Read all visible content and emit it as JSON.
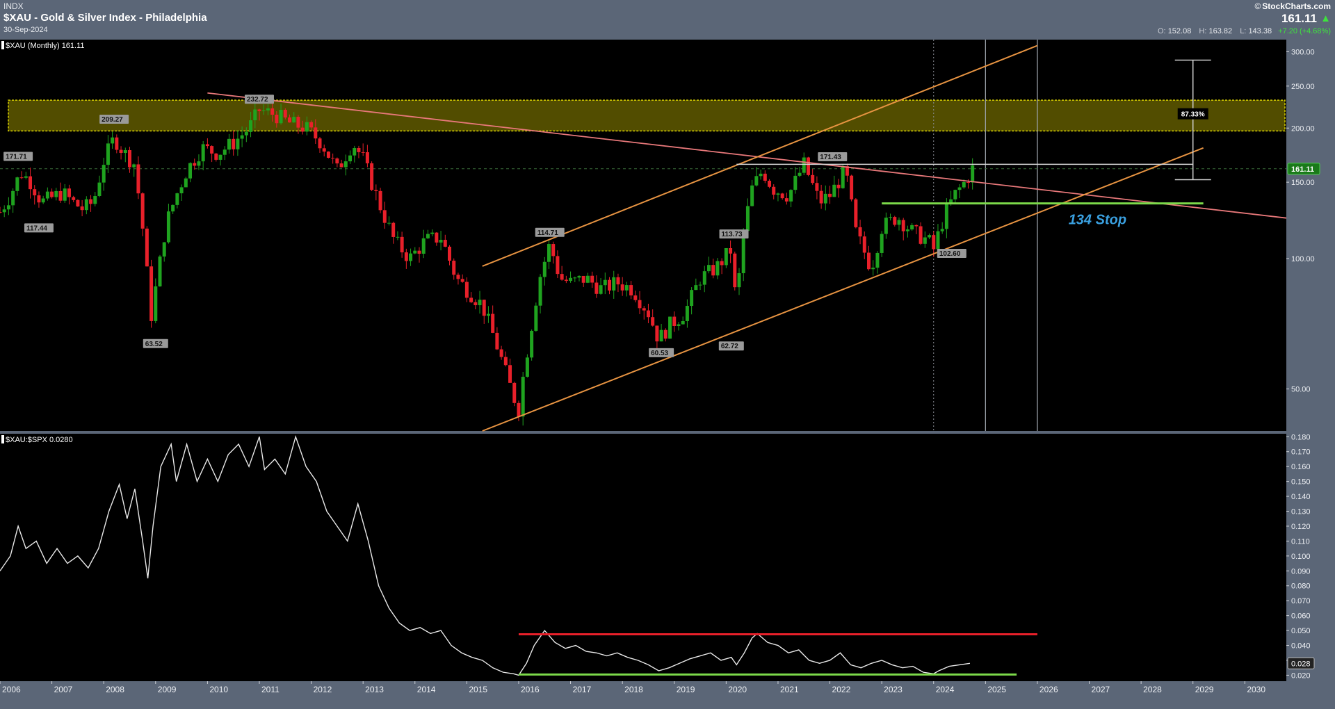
{
  "header": {
    "exchange": "INDX",
    "title": "$XAU - Gold & Silver Index - Philadelphia",
    "date": "30-Sep-2024",
    "brand": "StockCharts.com",
    "copyright": "©",
    "last_price": "161.11",
    "up_arrow": "▲",
    "open_label": "O:",
    "open": "152.08",
    "high_label": "H:",
    "high": "163.82",
    "low_label": "L:",
    "low": "143.38",
    "change": "+7.20 (+4.68%)"
  },
  "colors": {
    "panel_bg": "#000000",
    "frame": "#5b6677",
    "up_candle": "#1fa31f",
    "down_candle": "#e8202a",
    "trendline": "#e8787a",
    "channel": "#e89442",
    "zone": "#d8d000",
    "support": "#7cd94a",
    "resistance": "#e8202a",
    "ratio_line": "#e8e8e8",
    "stop_text": "#3aa0e0"
  },
  "icons": {
    "up_arrow": "triangle-up-icon"
  },
  "chart_data": [
    {
      "type": "candlestick",
      "legend": "$XAU (Monthly) 161.11",
      "scale": "log",
      "ylim": [
        40,
        320
      ],
      "y_ticks": [
        "50.00",
        "100.00",
        "150.00",
        "200.00",
        "250.00",
        "300.00"
      ],
      "y_tick_values": [
        50,
        100,
        150,
        200,
        250,
        300
      ],
      "x_ticks": [
        "2006",
        "2007",
        "2008",
        "2009",
        "2010",
        "2011",
        "2012",
        "2013",
        "2014",
        "2015",
        "2016",
        "2017",
        "2018",
        "2019",
        "2020",
        "2021",
        "2022",
        "2023",
        "2024",
        "2025",
        "2026",
        "2027",
        "2028",
        "2029",
        "2030"
      ],
      "xlim": [
        2006,
        2030.8
      ],
      "close_series": [
        [
          2006.0,
          128
        ],
        [
          2006.2,
          140
        ],
        [
          2006.4,
          158
        ],
        [
          2006.6,
          150
        ],
        [
          2006.8,
          135
        ],
        [
          2007.0,
          138
        ],
        [
          2007.2,
          142
        ],
        [
          2007.4,
          135
        ],
        [
          2007.6,
          130
        ],
        [
          2007.8,
          135
        ],
        [
          2008.0,
          168
        ],
        [
          2008.2,
          190
        ],
        [
          2008.4,
          175
        ],
        [
          2008.6,
          165
        ],
        [
          2008.8,
          105
        ],
        [
          2008.9,
          72
        ],
        [
          2009.0,
          85
        ],
        [
          2009.2,
          120
        ],
        [
          2009.4,
          140
        ],
        [
          2009.6,
          160
        ],
        [
          2009.9,
          180
        ],
        [
          2010.2,
          175
        ],
        [
          2010.5,
          185
        ],
        [
          2010.8,
          200
        ],
        [
          2011.0,
          220
        ],
        [
          2011.3,
          215
        ],
        [
          2011.6,
          205
        ],
        [
          2011.9,
          200
        ],
        [
          2012.2,
          185
        ],
        [
          2012.5,
          160
        ],
        [
          2012.8,
          185
        ],
        [
          2013.0,
          170
        ],
        [
          2013.3,
          135
        ],
        [
          2013.6,
          110
        ],
        [
          2013.9,
          100
        ],
        [
          2014.2,
          110
        ],
        [
          2014.5,
          112
        ],
        [
          2014.8,
          90
        ],
        [
          2015.0,
          85
        ],
        [
          2015.3,
          78
        ],
        [
          2015.6,
          62
        ],
        [
          2015.9,
          48
        ],
        [
          2016.0,
          45
        ],
        [
          2016.1,
          55
        ],
        [
          2016.4,
          90
        ],
        [
          2016.6,
          108
        ],
        [
          2016.8,
          90
        ],
        [
          2017.0,
          88
        ],
        [
          2017.3,
          90
        ],
        [
          2017.6,
          85
        ],
        [
          2017.9,
          88
        ],
        [
          2018.2,
          85
        ],
        [
          2018.5,
          75
        ],
        [
          2018.7,
          65
        ],
        [
          2018.9,
          70
        ],
        [
          2019.2,
          75
        ],
        [
          2019.5,
          90
        ],
        [
          2019.8,
          95
        ],
        [
          2020.1,
          105
        ],
        [
          2020.2,
          75
        ],
        [
          2020.3,
          110
        ],
        [
          2020.5,
          145
        ],
        [
          2020.7,
          160
        ],
        [
          2020.9,
          145
        ],
        [
          2021.2,
          140
        ],
        [
          2021.5,
          165
        ],
        [
          2021.8,
          135
        ],
        [
          2022.0,
          140
        ],
        [
          2022.3,
          160
        ],
        [
          2022.5,
          115
        ],
        [
          2022.8,
          95
        ],
        [
          2023.0,
          118
        ],
        [
          2023.3,
          125
        ],
        [
          2023.6,
          115
        ],
        [
          2023.9,
          110
        ],
        [
          2024.0,
          105
        ],
        [
          2024.2,
          125
        ],
        [
          2024.4,
          140
        ],
        [
          2024.6,
          150
        ],
        [
          2024.75,
          161
        ]
      ],
      "labels": [
        {
          "x": 2006.35,
          "y": 171.71,
          "text": "171.71"
        },
        {
          "x": 2006.75,
          "y": 117.44,
          "text": "117.44"
        },
        {
          "x": 2008.2,
          "y": 209.27,
          "text": "209.27"
        },
        {
          "x": 2009.0,
          "y": 63.52,
          "text": "63.52"
        },
        {
          "x": 2011.0,
          "y": 232.72,
          "text": "232.72"
        },
        {
          "x": 2016.6,
          "y": 114.71,
          "text": "114.71"
        },
        {
          "x": 2018.75,
          "y": 60.53,
          "text": "60.53"
        },
        {
          "x": 2020.1,
          "y": 62.72,
          "text": "62.72"
        },
        {
          "x": 2020.15,
          "y": 113.73,
          "text": "113.73"
        },
        {
          "x": 2022.05,
          "y": 171.43,
          "text": "171.43"
        },
        {
          "x": 2024.35,
          "y": 102.6,
          "text": "102.60"
        }
      ],
      "annotations": {
        "resistance_zone": [
          197,
          232
        ],
        "measured_move_label": "87.33%",
        "measured_move_range": [
          152,
          287
        ],
        "measured_move_x": 2029.0,
        "stop_text": "134 Stop",
        "stop_level": 134,
        "stop_x_range": [
          2023.0,
          2029.2
        ],
        "stop_text_pos": {
          "x": 2026.6,
          "y": 120
        },
        "high_ref_level": 165,
        "high_ref_x_range": [
          2020.2,
          2029.0
        ],
        "downtrend": [
          [
            2010.0,
            241
          ],
          [
            2030.8,
            124
          ]
        ],
        "channel_lower": [
          [
            2015.3,
            40
          ],
          [
            2029.2,
            180
          ]
        ],
        "channel_upper": [
          [
            2015.3,
            96
          ],
          [
            2026.0,
            310
          ]
        ],
        "vlines": [
          2025.0,
          2026.0
        ],
        "dotted_vline": 2024.0,
        "current_level": 161.11,
        "current_label": "161.11"
      }
    },
    {
      "type": "line",
      "legend": "$XAU:$SPX 0.0280",
      "ylim": [
        0.016,
        0.182
      ],
      "y_ticks": [
        "0.020",
        "0.030",
        "0.040",
        "0.050",
        "0.060",
        "0.070",
        "0.080",
        "0.090",
        "0.100",
        "0.110",
        "0.120",
        "0.130",
        "0.140",
        "0.150",
        "0.160",
        "0.170",
        "0.180"
      ],
      "y_tick_values": [
        0.02,
        0.03,
        0.04,
        0.05,
        0.06,
        0.07,
        0.08,
        0.09,
        0.1,
        0.11,
        0.12,
        0.13,
        0.14,
        0.15,
        0.16,
        0.17,
        0.18
      ],
      "series": [
        [
          2006.0,
          0.09
        ],
        [
          2006.2,
          0.1
        ],
        [
          2006.35,
          0.12
        ],
        [
          2006.5,
          0.105
        ],
        [
          2006.7,
          0.11
        ],
        [
          2006.9,
          0.095
        ],
        [
          2007.1,
          0.105
        ],
        [
          2007.3,
          0.095
        ],
        [
          2007.5,
          0.1
        ],
        [
          2007.7,
          0.092
        ],
        [
          2007.9,
          0.105
        ],
        [
          2008.1,
          0.13
        ],
        [
          2008.3,
          0.148
        ],
        [
          2008.45,
          0.125
        ],
        [
          2008.6,
          0.145
        ],
        [
          2008.75,
          0.11
        ],
        [
          2008.85,
          0.085
        ],
        [
          2008.95,
          0.12
        ],
        [
          2009.1,
          0.16
        ],
        [
          2009.3,
          0.175
        ],
        [
          2009.4,
          0.15
        ],
        [
          2009.6,
          0.175
        ],
        [
          2009.8,
          0.15
        ],
        [
          2010.0,
          0.165
        ],
        [
          2010.2,
          0.15
        ],
        [
          2010.4,
          0.168
        ],
        [
          2010.6,
          0.175
        ],
        [
          2010.8,
          0.16
        ],
        [
          2011.0,
          0.18
        ],
        [
          2011.1,
          0.158
        ],
        [
          2011.3,
          0.165
        ],
        [
          2011.5,
          0.155
        ],
        [
          2011.7,
          0.18
        ],
        [
          2011.9,
          0.16
        ],
        [
          2012.1,
          0.15
        ],
        [
          2012.3,
          0.13
        ],
        [
          2012.5,
          0.12
        ],
        [
          2012.7,
          0.11
        ],
        [
          2012.9,
          0.135
        ],
        [
          2013.1,
          0.11
        ],
        [
          2013.3,
          0.08
        ],
        [
          2013.5,
          0.065
        ],
        [
          2013.7,
          0.055
        ],
        [
          2013.9,
          0.05
        ],
        [
          2014.1,
          0.052
        ],
        [
          2014.3,
          0.048
        ],
        [
          2014.5,
          0.05
        ],
        [
          2014.7,
          0.04
        ],
        [
          2014.9,
          0.035
        ],
        [
          2015.1,
          0.032
        ],
        [
          2015.3,
          0.03
        ],
        [
          2015.5,
          0.025
        ],
        [
          2015.7,
          0.022
        ],
        [
          2015.9,
          0.021
        ],
        [
          2016.0,
          0.02
        ],
        [
          2016.15,
          0.028
        ],
        [
          2016.3,
          0.04
        ],
        [
          2016.5,
          0.05
        ],
        [
          2016.7,
          0.042
        ],
        [
          2016.9,
          0.038
        ],
        [
          2017.1,
          0.04
        ],
        [
          2017.3,
          0.036
        ],
        [
          2017.5,
          0.035
        ],
        [
          2017.7,
          0.033
        ],
        [
          2017.9,
          0.035
        ],
        [
          2018.1,
          0.032
        ],
        [
          2018.3,
          0.03
        ],
        [
          2018.5,
          0.027
        ],
        [
          2018.7,
          0.023
        ],
        [
          2018.9,
          0.025
        ],
        [
          2019.1,
          0.028
        ],
        [
          2019.3,
          0.031
        ],
        [
          2019.5,
          0.033
        ],
        [
          2019.7,
          0.035
        ],
        [
          2019.9,
          0.03
        ],
        [
          2020.1,
          0.032
        ],
        [
          2020.2,
          0.027
        ],
        [
          2020.35,
          0.035
        ],
        [
          2020.5,
          0.045
        ],
        [
          2020.6,
          0.048
        ],
        [
          2020.8,
          0.042
        ],
        [
          2021.0,
          0.04
        ],
        [
          2021.2,
          0.035
        ],
        [
          2021.4,
          0.037
        ],
        [
          2021.6,
          0.03
        ],
        [
          2021.8,
          0.028
        ],
        [
          2022.0,
          0.03
        ],
        [
          2022.2,
          0.035
        ],
        [
          2022.4,
          0.027
        ],
        [
          2022.6,
          0.025
        ],
        [
          2022.8,
          0.028
        ],
        [
          2023.0,
          0.03
        ],
        [
          2023.2,
          0.027
        ],
        [
          2023.4,
          0.025
        ],
        [
          2023.6,
          0.026
        ],
        [
          2023.8,
          0.022
        ],
        [
          2024.0,
          0.021
        ],
        [
          2024.1,
          0.023
        ],
        [
          2024.3,
          0.026
        ],
        [
          2024.5,
          0.027
        ],
        [
          2024.7,
          0.028
        ]
      ],
      "resistance_level": 0.0475,
      "resistance_x_range": [
        2016.0,
        2026.0
      ],
      "support_level": 0.0205,
      "support_x_range": [
        2016.0,
        2025.6
      ],
      "current_label": "0.028",
      "current_level": 0.028
    }
  ]
}
